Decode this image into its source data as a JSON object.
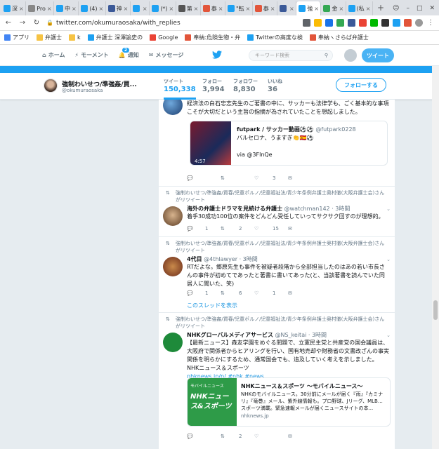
{
  "browser": {
    "tabs": [
      {
        "label": "深",
        "color": "#1da1f2"
      },
      {
        "label": "Pro",
        "color": "#888888"
      },
      {
        "label": "中",
        "color": "#1da1f2"
      },
      {
        "label": "(4)",
        "color": "#1da1f2"
      },
      {
        "label": "神",
        "color": "#3b5998"
      },
      {
        "label": "",
        "color": "#1da1f2"
      },
      {
        "label": "(*)",
        "color": "#1da1f2"
      },
      {
        "label": "第",
        "color": "#555555"
      },
      {
        "label": "泰",
        "color": "#e2553a"
      },
      {
        "label": "\"転",
        "color": "#1da1f2"
      },
      {
        "label": "泰",
        "color": "#e2553a"
      },
      {
        "label": "",
        "color": "#3b5998"
      },
      {
        "label": "強",
        "color": "#1da1f2"
      },
      {
        "label": "金",
        "color": "#34a853"
      },
      {
        "label": "(私",
        "color": "#1da1f2"
      }
    ],
    "address": "twitter.com/okumuraosaka/with_replies",
    "bookmarks": [
      {
        "label": "アプリ",
        "color": "#4285f4"
      },
      {
        "label": "弁護士",
        "color": "#f6c344"
      },
      {
        "label": "k",
        "color": "#f6c344"
      },
      {
        "label": "弁護士 深澤諭史の",
        "color": "#1da1f2"
      },
      {
        "label": "Google",
        "color": "#ea4335"
      },
      {
        "label": "奉納:危険生物・弁",
        "color": "#e2553a"
      },
      {
        "label": "Twitterの高度な検",
        "color": "#1da1f2"
      },
      {
        "label": "奉納ヽさらば弁護士",
        "color": "#e2553a"
      }
    ]
  },
  "twnav": {
    "home": "ホーム",
    "moments": "モーメント",
    "notifications": "通知",
    "notif_count": "2",
    "messages": "メッセージ",
    "search_placeholder": "キーワード検索",
    "tweet_button": "ツイート"
  },
  "profile": {
    "name": "強制わいせつ/準強姦/買...",
    "handle": "@okumuraosaka",
    "stats": [
      {
        "label": "ツイート",
        "value": "150,338"
      },
      {
        "label": "フォロー",
        "value": "3,994"
      },
      {
        "label": "フォロワー",
        "value": "8,830"
      },
      {
        "label": "いいね",
        "value": "36"
      }
    ],
    "follow_button": "フォローする"
  },
  "timeline": {
    "t1": {
      "text": "経済法の白石忠志先生のご著書の中に、サッカーも法律学も、ごく基本的な事項こそが大切だという主旨の指摘が為されていたことを想起しました。",
      "card_name": "futpark / サッカー動画⚽⚽",
      "card_handle": "@futpark0228",
      "card_text": "バルセロナ、うますぎ👏🇪🇸⚽",
      "card_via": "via @3FlnQe",
      "video_time": "4:57",
      "reply": "",
      "retweet": "",
      "like": "3"
    },
    "t2": {
      "rt_by": "強制わいせつ/準強姦/買春/児童ポルノ/児童福祉法/青少年条例弁護士奥村徹(大阪弁護士会)さんがリツイート",
      "name": "海外の弁護士ドラマを見続ける弁護士",
      "handle": "@watchman142",
      "time": "· 3時間",
      "text": "着手30成功100位の案件をどんどん受任していってサクサク回すのが理想的。",
      "reply": "1",
      "retweet": "2",
      "like": "15"
    },
    "t3": {
      "rt_by": "強制わいせつ/準強姦/買春/児童ポルノ/児童福祉法/青少年条例弁護士奥村徹(大阪弁護士会)さんがリツイート",
      "name": "4代目",
      "handle": "@4thlawyer",
      "time": "· 3時間",
      "text": "RTだよな。郷原先生も事件を被疑者段階から全部担当したのはあの若い市長さんの事件が初めてであったと著書に書いてあった(と、当該著書を読んでいた同居人に聞いた、笑)",
      "reply": "1",
      "retweet": "6",
      "like": "1",
      "show_thread": "このスレッドを表示"
    },
    "t4": {
      "rt_by": "強制わいせつ/準強姦/買春/児童ポルノ/児童福祉法/青少年条例弁護士奥村徹(大阪弁護士会)さんがリツイート",
      "name": "NHKグローバルメディアサービス",
      "handle": "@NS_keitai",
      "time": "· 3時間",
      "text": "【最新ニュース】森友学園をめぐる問題で、立憲民主党と共産党の国会議員は、大阪府で関係者からヒアリングを行い、国有地売却や財務省の文書改ざんの事実関係を明らかにするため、通常国会でも、追及していく考えを示しました。NHKニュース＆スポーツ",
      "link": "nhknews.jp/p/ #nhk #news",
      "card_title": "NHKニュース＆スポーツ 〜モバイルニュース〜",
      "card_desc": "NHKのモバイルニュース。30分前にメールが届く『雨』『カミナリ』『竜巻』メール、紫外線情報も。プロ野球、Jリーグ、MLB…スポーツ満載。緊急速報メールが届くニュースサイトの本...",
      "card_domain": "nhknews.jp",
      "card_img_top": "モバイルニュース",
      "card_img_main": "NHKニュース&スポーツ",
      "reply": "",
      "retweet": "2",
      "like": ""
    }
  }
}
